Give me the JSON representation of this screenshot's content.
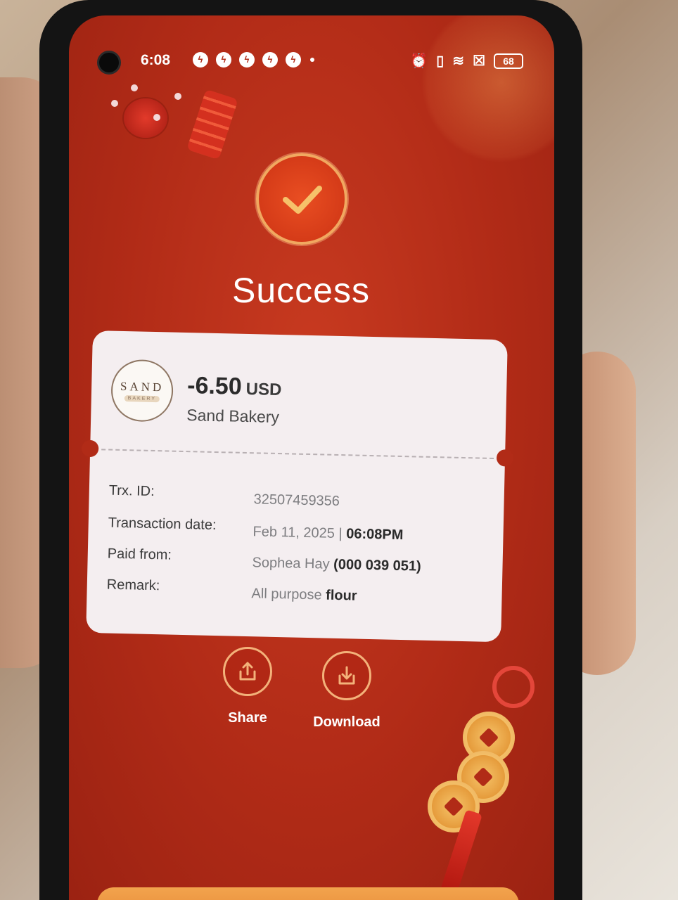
{
  "status_bar": {
    "time": "6:08",
    "battery": "68"
  },
  "header": {
    "title": "Success"
  },
  "receipt": {
    "logo": {
      "main": "SAND",
      "sub": "BAKERY"
    },
    "amount": "-6.50",
    "currency": "USD",
    "merchant": "Sand Bakery",
    "rows": [
      {
        "label": "Trx. ID:",
        "value_light": "32507459356",
        "value_bold": ""
      },
      {
        "label": "Transaction date:",
        "value_light": "Feb 11, 2025 | ",
        "value_bold": "06:08PM"
      },
      {
        "label": "Paid from:",
        "value_light": "Sophea Hay ",
        "value_bold": "(000 039 051)"
      },
      {
        "label": "Remark:",
        "value_light": "All purpose ",
        "value_bold": "flour"
      }
    ]
  },
  "actions": {
    "share_label": "Share",
    "download_label": "Download"
  },
  "icons": {
    "check": "check-icon",
    "share": "share-icon",
    "download": "download-icon"
  },
  "colors": {
    "background_red": "#b12b17",
    "accent_orange": "#f3b27a",
    "card_bg": "#f4eef0"
  }
}
